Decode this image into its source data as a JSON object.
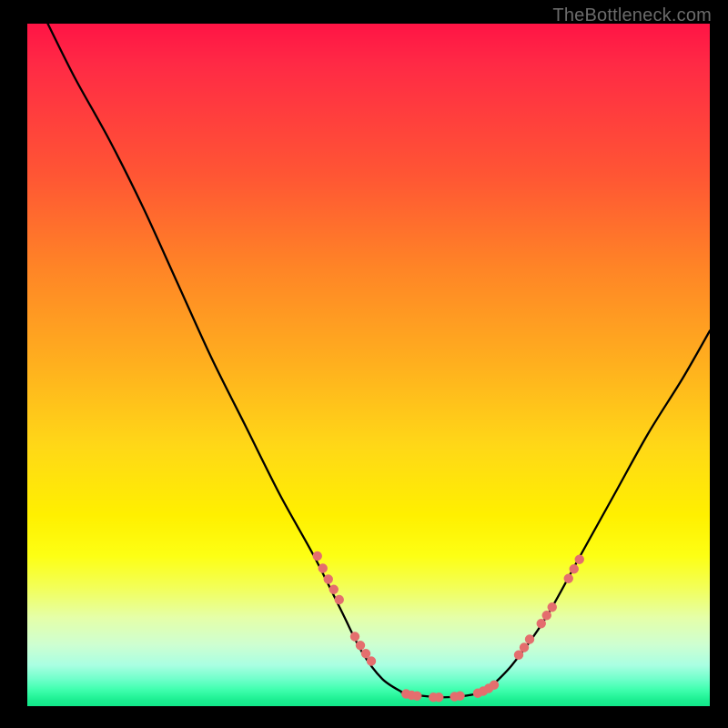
{
  "watermark": "TheBottleneck.com",
  "colors": {
    "background": "#000000",
    "curve": "#000000",
    "marker": "#e46e6e",
    "watermark_text": "#6b6b6b",
    "gradient_top": "#ff1445",
    "gradient_mid": "#fff000",
    "gradient_bottom": "#12e78a"
  },
  "chart_data": {
    "type": "line",
    "title": "",
    "xlabel": "",
    "ylabel": "",
    "xlim": [
      0,
      100
    ],
    "ylim": [
      0,
      100
    ],
    "grid": false,
    "legend": false,
    "annotations": [
      "TheBottleneck.com"
    ],
    "series": [
      {
        "name": "left-curve",
        "x": [
          3,
          7,
          12,
          17,
          22,
          27,
          32,
          37,
          42,
          46,
          49,
          52,
          55
        ],
        "values": [
          100,
          92,
          83,
          73,
          62,
          51,
          41,
          31,
          22,
          14,
          8,
          4,
          2
        ]
      },
      {
        "name": "floor",
        "x": [
          55,
          58,
          61,
          64,
          67
        ],
        "values": [
          2,
          1.5,
          1.3,
          1.5,
          2
        ]
      },
      {
        "name": "right-curve",
        "x": [
          67,
          71,
          76,
          81,
          86,
          91,
          96,
          100
        ],
        "values": [
          2,
          6,
          13,
          22,
          31,
          40,
          48,
          55
        ]
      }
    ],
    "markers": [
      {
        "name": "left-cluster-upper",
        "x": [
          42.5,
          43.3,
          44.1,
          44.9,
          45.7
        ],
        "y": [
          22,
          20.2,
          18.6,
          17.1,
          15.6
        ]
      },
      {
        "name": "left-cluster-lower",
        "x": [
          48.0,
          48.8,
          49.6,
          50.4
        ],
        "y": [
          10.2,
          8.9,
          7.7,
          6.6
        ]
      },
      {
        "name": "floor-cluster-a",
        "x": [
          55.5,
          56.3,
          57.1,
          59.5,
          60.3,
          62.6,
          63.4
        ],
        "y": [
          1.8,
          1.6,
          1.5,
          1.3,
          1.3,
          1.4,
          1.5
        ]
      },
      {
        "name": "floor-cluster-b",
        "x": [
          66.0,
          66.8,
          67.6,
          68.4
        ],
        "y": [
          1.9,
          2.2,
          2.6,
          3.1
        ]
      },
      {
        "name": "right-cluster-lower",
        "x": [
          72.0,
          72.8,
          73.6,
          75.3,
          76.1,
          76.9
        ],
        "y": [
          7.5,
          8.6,
          9.8,
          12.1,
          13.3,
          14.5
        ]
      },
      {
        "name": "right-cluster-upper",
        "x": [
          79.3,
          80.1,
          80.9
        ],
        "y": [
          18.7,
          20.1,
          21.5
        ]
      }
    ]
  }
}
